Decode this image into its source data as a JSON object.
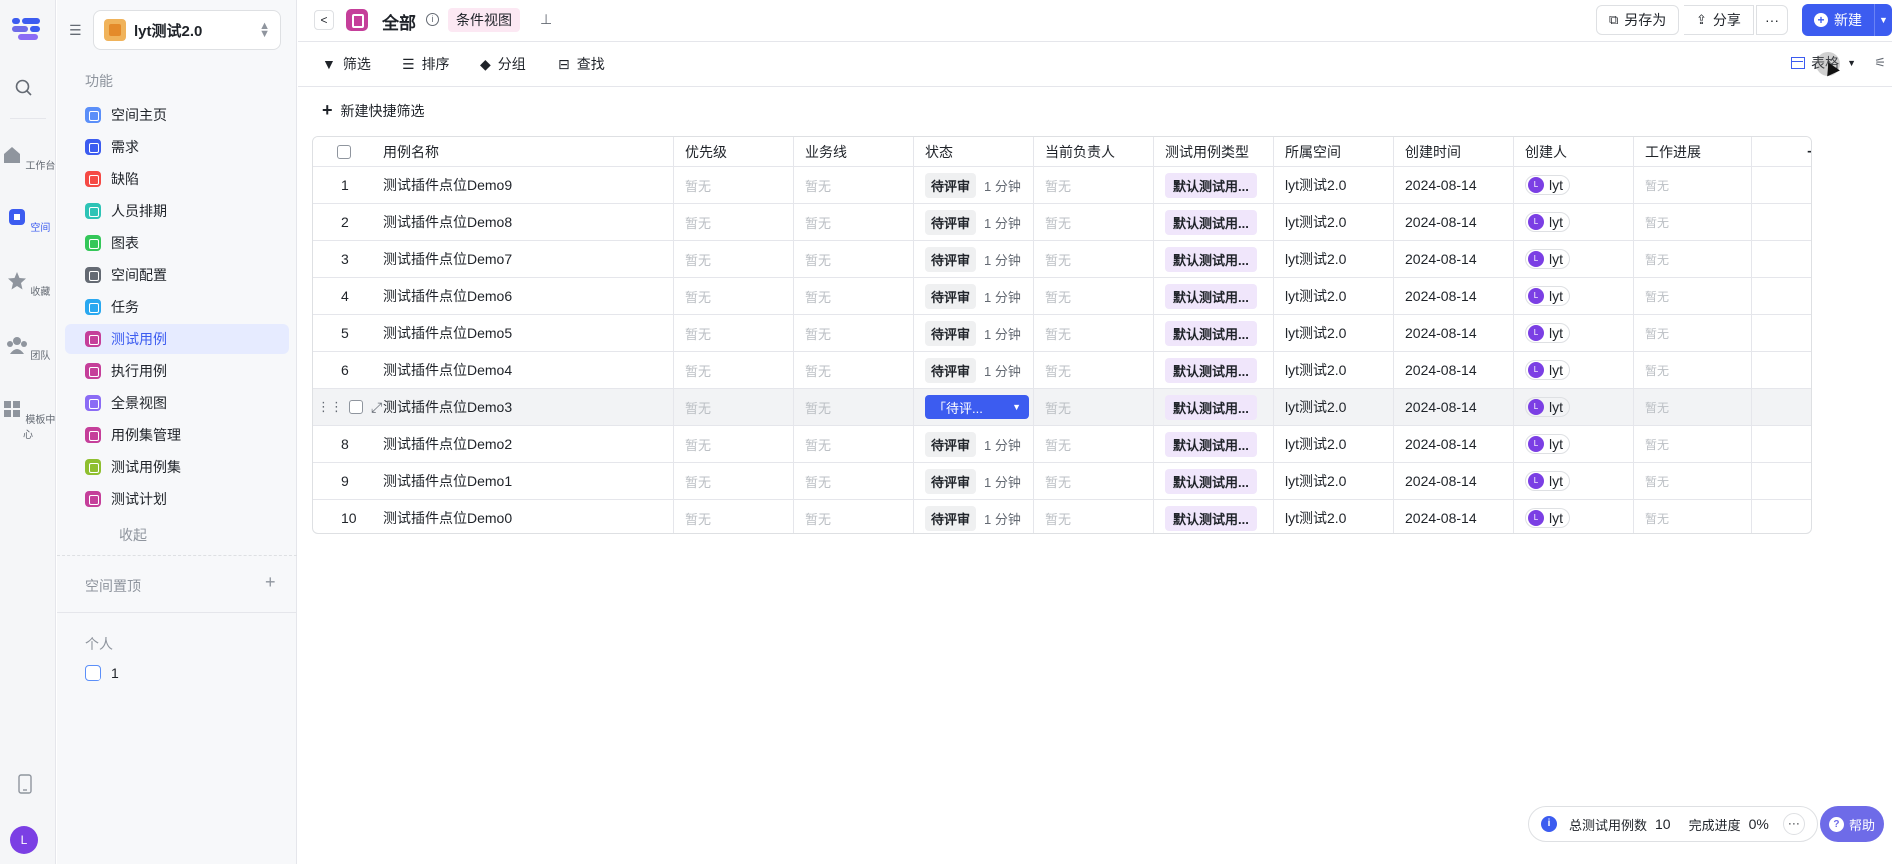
{
  "rail": {
    "items": [
      {
        "label": "工作台"
      },
      {
        "label": "空间"
      },
      {
        "label": "收藏"
      },
      {
        "label": "团队"
      },
      {
        "label": "模板中心"
      }
    ],
    "avatar": "L"
  },
  "sidebar": {
    "project": "lyt测试2.0",
    "section_features": "功能",
    "items": [
      {
        "label": "空间主页",
        "color": "#5b8ff9"
      },
      {
        "label": "需求",
        "color": "#3c5cf0"
      },
      {
        "label": "缺陷",
        "color": "#f54a45"
      },
      {
        "label": "人员排期",
        "color": "#2ec4b6"
      },
      {
        "label": "图表",
        "color": "#34c759"
      },
      {
        "label": "空间配置",
        "color": "#646a73"
      },
      {
        "label": "任务",
        "color": "#29a8f0"
      },
      {
        "label": "测试用例",
        "color": "#c53f9a"
      },
      {
        "label": "执行用例",
        "color": "#c53f9a"
      },
      {
        "label": "全景视图",
        "color": "#8b6cf5"
      },
      {
        "label": "用例集管理",
        "color": "#c53f9a"
      },
      {
        "label": "测试用例集",
        "color": "#8fbf2f"
      },
      {
        "label": "测试计划",
        "color": "#c53f9a"
      }
    ],
    "collapse": "收起",
    "section_pinned": "空间置顶",
    "section_personal": "个人",
    "personal_items": [
      {
        "label": "1"
      }
    ]
  },
  "header": {
    "back": "<",
    "title": "全部",
    "info": "i",
    "view_badge": "条件视图",
    "pin": "푸",
    "save_as": "另存为",
    "share": "分享",
    "more": "···",
    "new": "新建"
  },
  "toolbar": {
    "filter": "筛选",
    "sort": "排序",
    "group": "分组",
    "find": "查找",
    "view": "表格"
  },
  "quick_filter": "新建快捷筛选",
  "table": {
    "columns": [
      "用例名称",
      "优先级",
      "业务线",
      "状态",
      "当前负责人",
      "测试用例类型",
      "所属空间",
      "创建时间",
      "创建人",
      "工作进展"
    ],
    "placeholder": "暂无",
    "rows": [
      {
        "idx": "1",
        "name": "测试插件点位Demo9",
        "status": "待评审",
        "dur": "1 分钟",
        "type": "默认测试用...",
        "space": "lyt测试2.0",
        "date": "2024-08-14",
        "creator": "lyt",
        "avatar": "L"
      },
      {
        "idx": "2",
        "name": "测试插件点位Demo8",
        "status": "待评审",
        "dur": "1 分钟",
        "type": "默认测试用...",
        "space": "lyt测试2.0",
        "date": "2024-08-14",
        "creator": "lyt",
        "avatar": "L"
      },
      {
        "idx": "3",
        "name": "测试插件点位Demo7",
        "status": "待评审",
        "dur": "1 分钟",
        "type": "默认测试用...",
        "space": "lyt测试2.0",
        "date": "2024-08-14",
        "creator": "lyt",
        "avatar": "L"
      },
      {
        "idx": "4",
        "name": "测试插件点位Demo6",
        "status": "待评审",
        "dur": "1 分钟",
        "type": "默认测试用...",
        "space": "lyt测试2.0",
        "date": "2024-08-14",
        "creator": "lyt",
        "avatar": "L"
      },
      {
        "idx": "5",
        "name": "测试插件点位Demo5",
        "status": "待评审",
        "dur": "1 分钟",
        "type": "默认测试用...",
        "space": "lyt测试2.0",
        "date": "2024-08-14",
        "creator": "lyt",
        "avatar": "L"
      },
      {
        "idx": "6",
        "name": "测试插件点位Demo4",
        "status": "待评审",
        "dur": "1 分钟",
        "type": "默认测试用...",
        "space": "lyt测试2.0",
        "date": "2024-08-14",
        "creator": "lyt",
        "avatar": "L"
      },
      {
        "idx": "",
        "name": "测试插件点位Demo3",
        "status": "「待评...",
        "dur": "",
        "type": "默认测试用...",
        "space": "lyt测试2.0",
        "date": "2024-08-14",
        "creator": "lyt",
        "avatar": "L",
        "selected": true
      },
      {
        "idx": "8",
        "name": "测试插件点位Demo2",
        "status": "待评审",
        "dur": "1 分钟",
        "type": "默认测试用...",
        "space": "lyt测试2.0",
        "date": "2024-08-14",
        "creator": "lyt",
        "avatar": "L"
      },
      {
        "idx": "9",
        "name": "测试插件点位Demo1",
        "status": "待评审",
        "dur": "1 分钟",
        "type": "默认测试用...",
        "space": "lyt测试2.0",
        "date": "2024-08-14",
        "creator": "lyt",
        "avatar": "L"
      },
      {
        "idx": "10",
        "name": "测试插件点位Demo0",
        "status": "待评审",
        "dur": "1 分钟",
        "type": "默认测试用...",
        "space": "lyt测试2.0",
        "date": "2024-08-14",
        "creator": "lyt",
        "avatar": "L"
      }
    ]
  },
  "footer": {
    "total_label": "总测试用例数",
    "total_value": "10",
    "progress_label": "完成进度",
    "progress_value": "0%",
    "more": "···",
    "help": "帮助"
  },
  "colors": {
    "accent": "#3c5cf0",
    "selected_nav_bg": "#e6ebff"
  }
}
